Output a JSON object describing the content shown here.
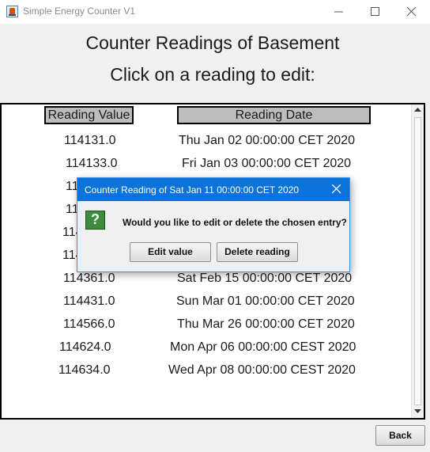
{
  "window": {
    "title": "Simple Energy Counter V1",
    "accent": "#0b73d9"
  },
  "header": {
    "title": "Counter Readings of Basement",
    "subtitle": "Click on a reading to edit:"
  },
  "table": {
    "columns": [
      "Reading Value",
      "Reading Date"
    ],
    "rows": [
      {
        "value": "114131.0",
        "date": "Thu Jan 02 00:00:00 CET 2020"
      },
      {
        "value": "114133.0",
        "date": "Fri Jan 03 00:00:00 CET 2020"
      },
      {
        "value": "11",
        "date": ""
      },
      {
        "value": "11",
        "date": ""
      },
      {
        "value": "114",
        "date": ""
      },
      {
        "value": "114",
        "date": ""
      },
      {
        "value": "114361.0",
        "date": "Sat Feb 15 00:00:00 CET 2020"
      },
      {
        "value": "114431.0",
        "date": "Sun Mar 01 00:00:00 CET 2020"
      },
      {
        "value": "114566.0",
        "date": "Thu Mar 26 00:00:00 CET 2020"
      },
      {
        "value": "114624.0",
        "date": "Mon Apr 06 00:00:00 CEST 2020"
      },
      {
        "value": "114634.0",
        "date": "Wed Apr 08 00:00:00 CEST 2020"
      }
    ]
  },
  "footer": {
    "back_label": "Back"
  },
  "dialog": {
    "title": "Counter Reading of Sat Jan 11 00:00:00 CET 2020",
    "icon": "question-icon",
    "icon_glyph": "?",
    "message": "Would you like to edit or delete the chosen entry?",
    "edit_label": "Edit value",
    "delete_label": "Delete reading"
  }
}
